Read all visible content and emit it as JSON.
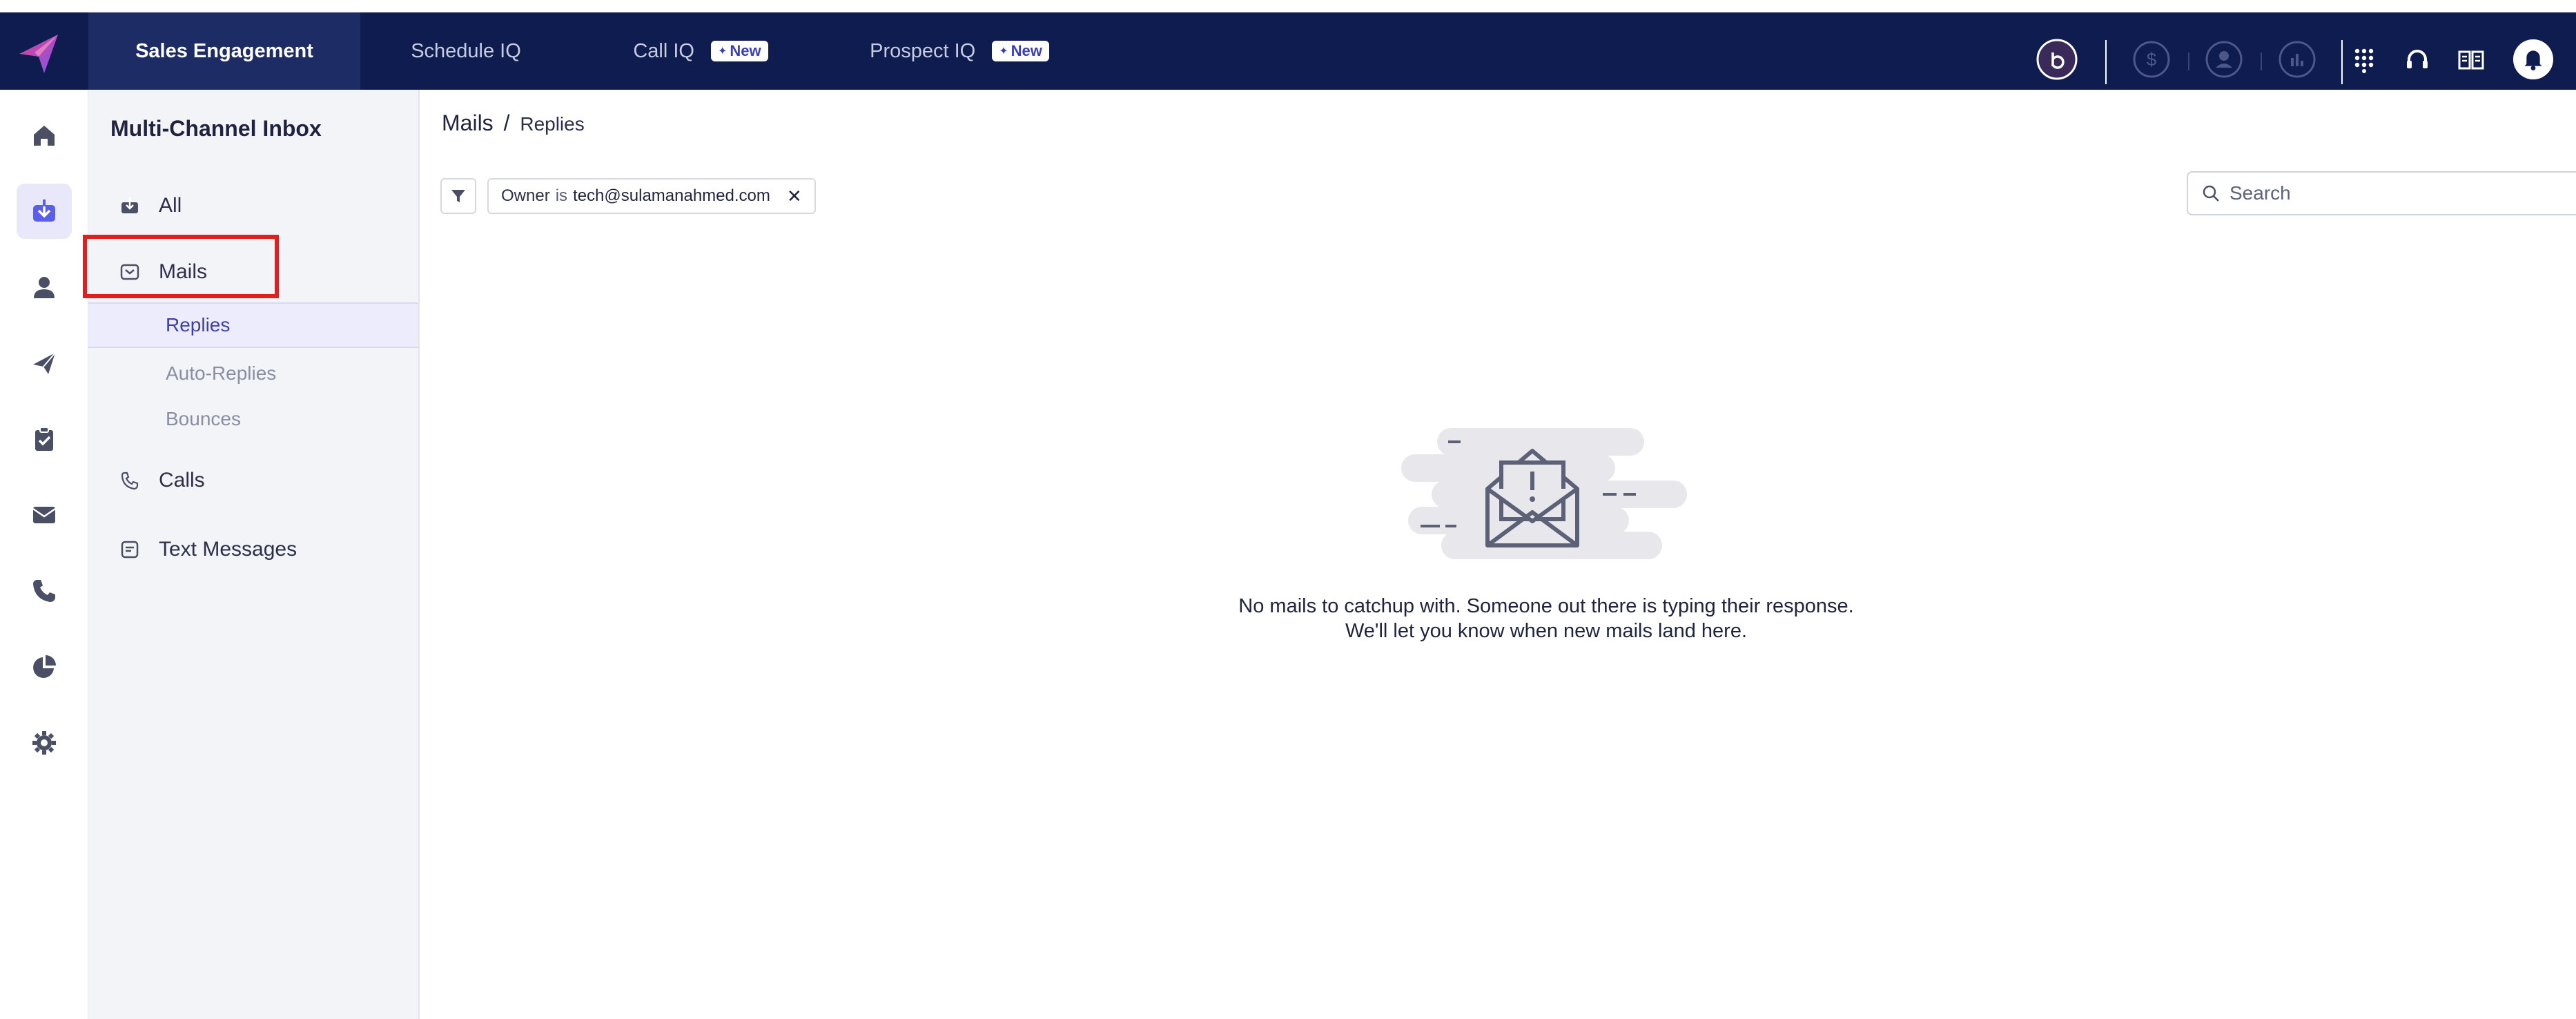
{
  "topbar": {
    "tabs": [
      {
        "label": "Sales Engagement",
        "badge": ""
      },
      {
        "label": "Schedule IQ",
        "badge": ""
      },
      {
        "label": "Call IQ",
        "badge": "New"
      },
      {
        "label": "Prospect IQ",
        "badge": "New"
      }
    ],
    "icons": [
      "account-switch-icon",
      "dollar-icon",
      "user-circle-icon",
      "chart-icon",
      "dialpad-icon",
      "headset-icon",
      "book-icon",
      "bell-icon"
    ]
  },
  "rail": {
    "items": [
      "home-icon",
      "inbox-icon",
      "person-icon",
      "send-icon",
      "clipboard-check-icon",
      "mail-icon",
      "phone-icon",
      "pie-chart-icon",
      "settings-icon"
    ],
    "active_index": 1
  },
  "sidebar": {
    "title": "Multi-Channel Inbox",
    "items": [
      {
        "label": "All"
      },
      {
        "label": "Mails"
      },
      {
        "label": "Calls"
      },
      {
        "label": "Text Messages"
      }
    ],
    "mail_subitems": [
      {
        "label": "Replies"
      },
      {
        "label": "Auto-Replies"
      },
      {
        "label": "Bounces"
      }
    ]
  },
  "main": {
    "breadcrumb": {
      "root": "Mails",
      "separator": "/",
      "leaf": "Replies"
    },
    "filter": {
      "field": "Owner",
      "operator": "is",
      "value": "tech@sulamanahmed.com"
    },
    "search": {
      "placeholder": "Search"
    },
    "empty_state": {
      "line1": "No mails to catchup with. Someone out there is typing their response.",
      "line2": "We'll let you know when new mails land here."
    }
  },
  "colors": {
    "topbar_bg": "#0f1c4f",
    "active_tab_bg": "#1e2c66",
    "accent": "#3d3fa8",
    "highlight_border": "#e02020"
  }
}
